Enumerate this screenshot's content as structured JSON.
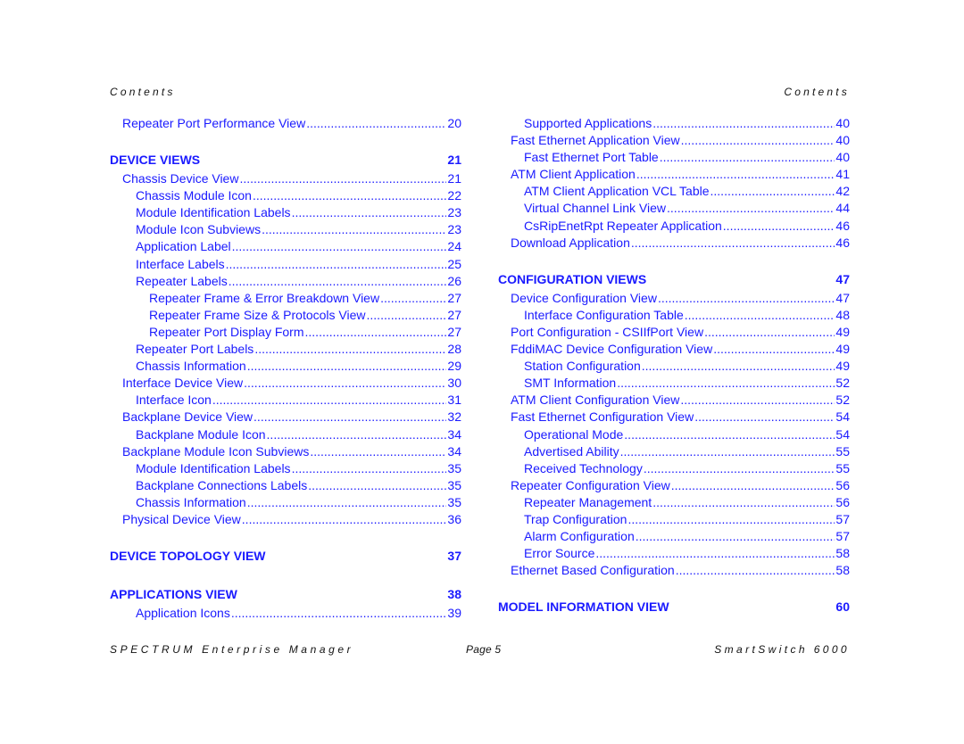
{
  "header": {
    "left": "Contents",
    "right": "Contents"
  },
  "left_column": [
    {
      "type": "entry",
      "level": 1,
      "title": "Repeater Port Performance View",
      "page": "20"
    },
    {
      "type": "section",
      "title": "DEVICE VIEWS",
      "page": "21"
    },
    {
      "type": "entry",
      "level": 1,
      "title": "Chassis Device View",
      "page": "21"
    },
    {
      "type": "entry",
      "level": 2,
      "title": "Chassis Module Icon",
      "page": "22"
    },
    {
      "type": "entry",
      "level": 2,
      "title": "Module Identification Labels",
      "page": "23"
    },
    {
      "type": "entry",
      "level": 2,
      "title": "Module Icon Subviews",
      "page": "23"
    },
    {
      "type": "entry",
      "level": 2,
      "title": "Application Label",
      "page": "24"
    },
    {
      "type": "entry",
      "level": 2,
      "title": "Interface Labels",
      "page": "25"
    },
    {
      "type": "entry",
      "level": 2,
      "title": "Repeater Labels",
      "page": "26"
    },
    {
      "type": "entry",
      "level": 3,
      "title": "Repeater Frame & Error Breakdown View",
      "page": "27"
    },
    {
      "type": "entry",
      "level": 3,
      "title": "Repeater Frame Size & Protocols View",
      "page": "27"
    },
    {
      "type": "entry",
      "level": 3,
      "title": "Repeater Port Display Form",
      "page": "27"
    },
    {
      "type": "entry",
      "level": 2,
      "title": "Repeater Port Labels",
      "page": "28"
    },
    {
      "type": "entry",
      "level": 2,
      "title": "Chassis Information",
      "page": "29"
    },
    {
      "type": "entry",
      "level": 1,
      "title": "Interface Device View",
      "page": "30"
    },
    {
      "type": "entry",
      "level": 2,
      "title": "Interface Icon",
      "page": "31"
    },
    {
      "type": "entry",
      "level": 1,
      "title": "Backplane Device View",
      "page": "32"
    },
    {
      "type": "entry",
      "level": 2,
      "title": "Backplane Module Icon",
      "page": "34"
    },
    {
      "type": "entry",
      "level": 1,
      "title": "Backplane Module Icon Subviews",
      "page": "34"
    },
    {
      "type": "entry",
      "level": 2,
      "title": "Module Identification Labels",
      "page": "35"
    },
    {
      "type": "entry",
      "level": 2,
      "title": "Backplane Connections Labels",
      "page": "35"
    },
    {
      "type": "entry",
      "level": 2,
      "title": "Chassis Information",
      "page": "35"
    },
    {
      "type": "entry",
      "level": 1,
      "title": "Physical Device View",
      "page": "36"
    },
    {
      "type": "section",
      "title": "DEVICE TOPOLOGY VIEW",
      "page": "37"
    },
    {
      "type": "section",
      "title": "APPLICATIONS VIEW",
      "page": "38"
    },
    {
      "type": "entry",
      "level": 2,
      "title": "Application Icons",
      "page": "39"
    }
  ],
  "right_column": [
    {
      "type": "entry",
      "level": 2,
      "title": "Supported Applications",
      "page": "40"
    },
    {
      "type": "entry",
      "level": 1,
      "title": "Fast Ethernet Application View",
      "page": "40"
    },
    {
      "type": "entry",
      "level": 2,
      "title": "Fast Ethernet Port Table",
      "page": "40"
    },
    {
      "type": "entry",
      "level": 1,
      "title": "ATM Client Application",
      "page": "41"
    },
    {
      "type": "entry",
      "level": 2,
      "title": "ATM Client Application VCL Table",
      "page": "42"
    },
    {
      "type": "entry",
      "level": 2,
      "title": "Virtual Channel Link View",
      "page": "44"
    },
    {
      "type": "entry",
      "level": 2,
      "title": "CsRipEnetRpt Repeater Application",
      "page": "46"
    },
    {
      "type": "entry",
      "level": 1,
      "title": "Download Application",
      "page": "46"
    },
    {
      "type": "section",
      "title": "CONFIGURATION VIEWS",
      "page": "47"
    },
    {
      "type": "entry",
      "level": 1,
      "title": "Device Configuration View",
      "page": "47"
    },
    {
      "type": "entry",
      "level": 2,
      "title": "Interface Configuration Table",
      "page": "48"
    },
    {
      "type": "entry",
      "level": 1,
      "title": "Port Configuration - CSIIfPort View",
      "page": "49"
    },
    {
      "type": "entry",
      "level": 1,
      "title": "FddiMAC Device Configuration View",
      "page": "49"
    },
    {
      "type": "entry",
      "level": 2,
      "title": "Station Configuration",
      "page": "49"
    },
    {
      "type": "entry",
      "level": 2,
      "title": "SMT Information",
      "page": "52"
    },
    {
      "type": "entry",
      "level": 1,
      "title": "ATM Client Configuration View",
      "page": "52"
    },
    {
      "type": "entry",
      "level": 1,
      "title": "Fast Ethernet Configuration View",
      "page": "54"
    },
    {
      "type": "entry",
      "level": 2,
      "title": "Operational Mode",
      "page": "54"
    },
    {
      "type": "entry",
      "level": 2,
      "title": "Advertised Ability",
      "page": "55"
    },
    {
      "type": "entry",
      "level": 2,
      "title": "Received Technology",
      "page": "55"
    },
    {
      "type": "entry",
      "level": 1,
      "title": "Repeater Configuration View",
      "page": "56"
    },
    {
      "type": "entry",
      "level": 2,
      "title": "Repeater Management",
      "page": "56"
    },
    {
      "type": "entry",
      "level": 2,
      "title": "Trap Configuration",
      "page": "57"
    },
    {
      "type": "entry",
      "level": 2,
      "title": "Alarm Configuration",
      "page": "57"
    },
    {
      "type": "entry",
      "level": 2,
      "title": "Error Source",
      "page": "58"
    },
    {
      "type": "entry",
      "level": 1,
      "title": "Ethernet Based Configuration",
      "page": "58"
    },
    {
      "type": "section",
      "title": "MODEL INFORMATION VIEW",
      "page": "60"
    }
  ],
  "footer": {
    "left": "SPECTRUM Enterprise Manager",
    "center": "Page 5",
    "right": "SmartSwitch 6000"
  },
  "colors": {
    "link": "#1a1aff",
    "text": "#111111"
  }
}
